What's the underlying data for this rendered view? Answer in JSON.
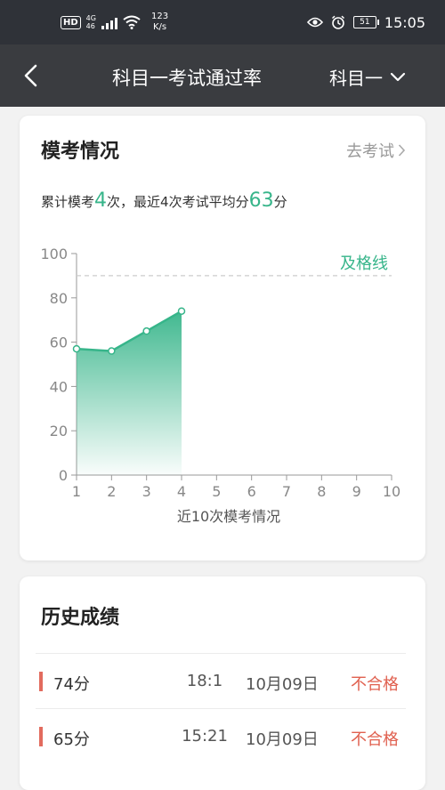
{
  "status_bar": {
    "hd": "HD",
    "net": "4G",
    "sub": "46",
    "speed_value": "123",
    "speed_unit": "K/s",
    "battery": "51",
    "time": "15:05"
  },
  "nav": {
    "title": "科目一考试通过率",
    "subject": "科目一"
  },
  "mock_section": {
    "title": "模考情况",
    "go_exam": "去考试",
    "summary_prefix": "累计模考",
    "total_count": "4",
    "summary_mid1": "次，最近",
    "recent_count": "4",
    "summary_mid2": "次考试平均分",
    "avg_score": "63",
    "summary_suffix": "分"
  },
  "chart_data": {
    "type": "area",
    "x": [
      1,
      2,
      3,
      4
    ],
    "values": [
      57,
      56,
      65,
      74
    ],
    "xlim": [
      1,
      10
    ],
    "ylim": [
      0,
      100
    ],
    "xticks": [
      "1",
      "2",
      "3",
      "4",
      "5",
      "6",
      "7",
      "8",
      "9",
      "10"
    ],
    "yticks": [
      "0",
      "20",
      "40",
      "60",
      "80",
      "100"
    ],
    "xlabel": "近10次模考情况",
    "pass_line": 90,
    "pass_label": "及格线",
    "color": "#37b58a"
  },
  "history": {
    "title": "历史成绩",
    "rows": [
      {
        "score": "74分",
        "duration": "18:1",
        "date": "10月09日",
        "result": "不合格"
      },
      {
        "score": "65分",
        "duration": "15:21",
        "date": "10月09日",
        "result": "不合格"
      }
    ]
  },
  "colors": {
    "accent": "#37b58a",
    "fail": "#e0604f",
    "navbar": "#3a3c40",
    "statusbar": "#2f3238"
  }
}
